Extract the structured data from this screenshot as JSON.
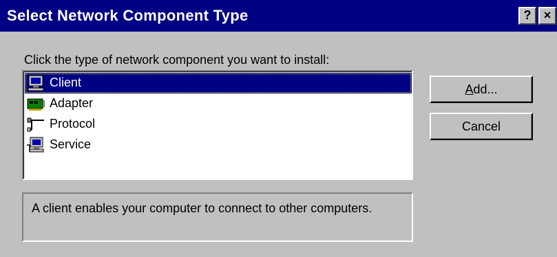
{
  "window": {
    "title": "Select Network Component Type",
    "help_button": "?",
    "close_button": "×"
  },
  "instruction": "Click the type of network component you want to install:",
  "list": {
    "items": [
      {
        "label": "Client",
        "icon": "client-computer-icon",
        "selected": true
      },
      {
        "label": "Adapter",
        "icon": "adapter-card-icon",
        "selected": false
      },
      {
        "label": "Protocol",
        "icon": "protocol-cable-icon",
        "selected": false
      },
      {
        "label": "Service",
        "icon": "service-computer-icon",
        "selected": false
      }
    ]
  },
  "buttons": {
    "add": "Add...",
    "cancel": "Cancel"
  },
  "description": "A client enables your computer to connect to other computers.",
  "colors": {
    "titlebar": "#000084",
    "face": "#c0c0c0",
    "selection": "#000084"
  }
}
